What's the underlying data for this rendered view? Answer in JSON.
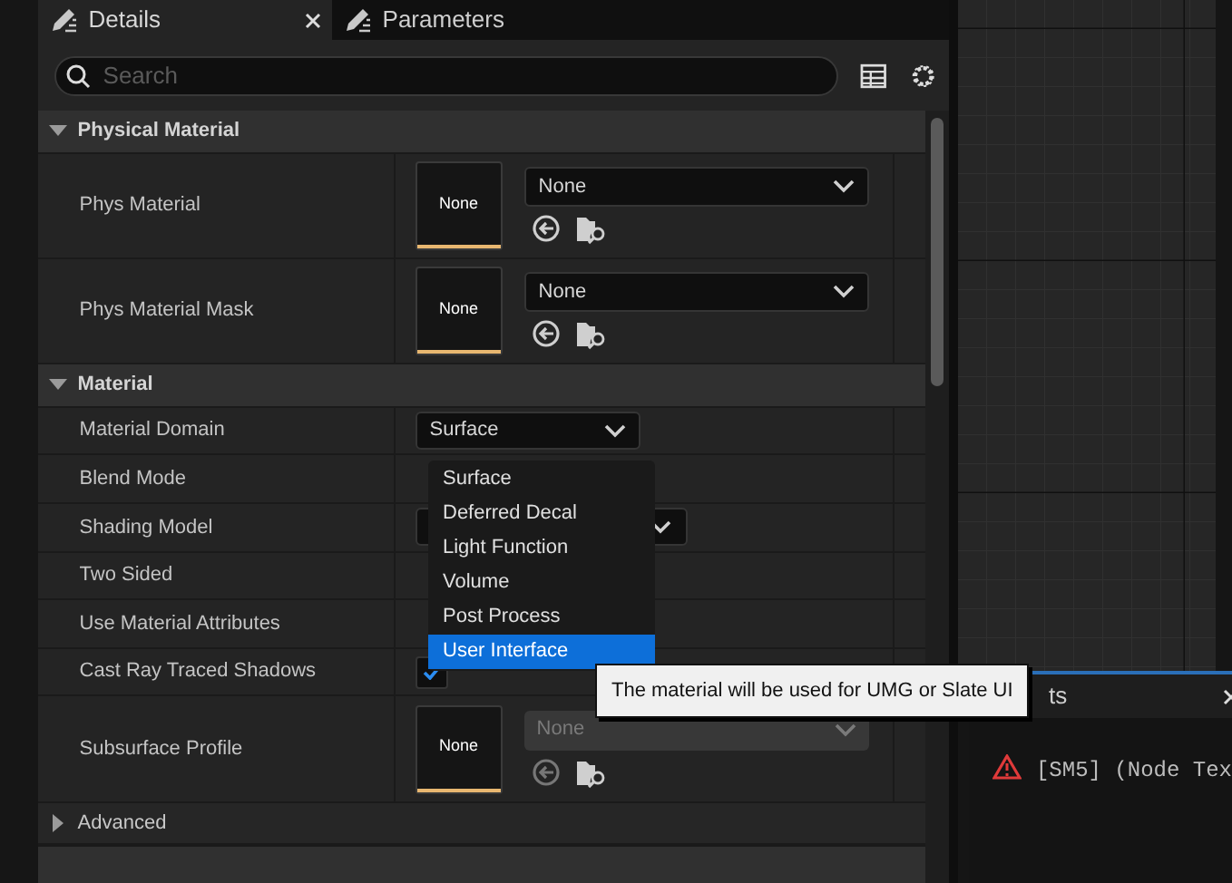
{
  "tabs": [
    {
      "label": "Details",
      "selected": true,
      "closable": true
    },
    {
      "label": "Parameters",
      "selected": false,
      "closable": false
    }
  ],
  "search": {
    "placeholder": "Search"
  },
  "sections": [
    {
      "title": "Physical Material",
      "expanded": true,
      "rows": [
        {
          "kind": "asset",
          "label": "Phys Material",
          "thumb": "None",
          "value": "None",
          "disabled": false
        },
        {
          "kind": "asset",
          "label": "Phys Material Mask",
          "thumb": "None",
          "value": "None",
          "disabled": false
        }
      ]
    },
    {
      "title": "Material",
      "expanded": true,
      "rows": [
        {
          "kind": "combo",
          "label": "Material Domain",
          "value": "Surface"
        },
        {
          "kind": "blank",
          "label": "Blend Mode"
        },
        {
          "kind": "covered-combo",
          "label": "Shading Model"
        },
        {
          "kind": "blank",
          "label": "Two Sided"
        },
        {
          "kind": "blank",
          "label": "Use Material Attributes"
        },
        {
          "kind": "checkbox",
          "label": "Cast Ray Traced Shadows",
          "checked": true
        },
        {
          "kind": "asset",
          "label": "Subsurface Profile",
          "thumb": "None",
          "value": "None",
          "disabled": true
        }
      ]
    },
    {
      "title": "Advanced",
      "expanded": false
    }
  ],
  "dropdown": {
    "options": [
      {
        "label": "Surface",
        "selected": false
      },
      {
        "label": "Deferred Decal",
        "selected": false
      },
      {
        "label": "Light Function",
        "selected": false
      },
      {
        "label": "Volume",
        "selected": false
      },
      {
        "label": "Post Process",
        "selected": false
      },
      {
        "label": "User Interface",
        "selected": true
      }
    ]
  },
  "tooltip": "The material will be used for UMG or Slate UI",
  "log_panel": {
    "tab": "ts",
    "closable": true,
    "message": "[SM5] (Node Tex"
  }
}
